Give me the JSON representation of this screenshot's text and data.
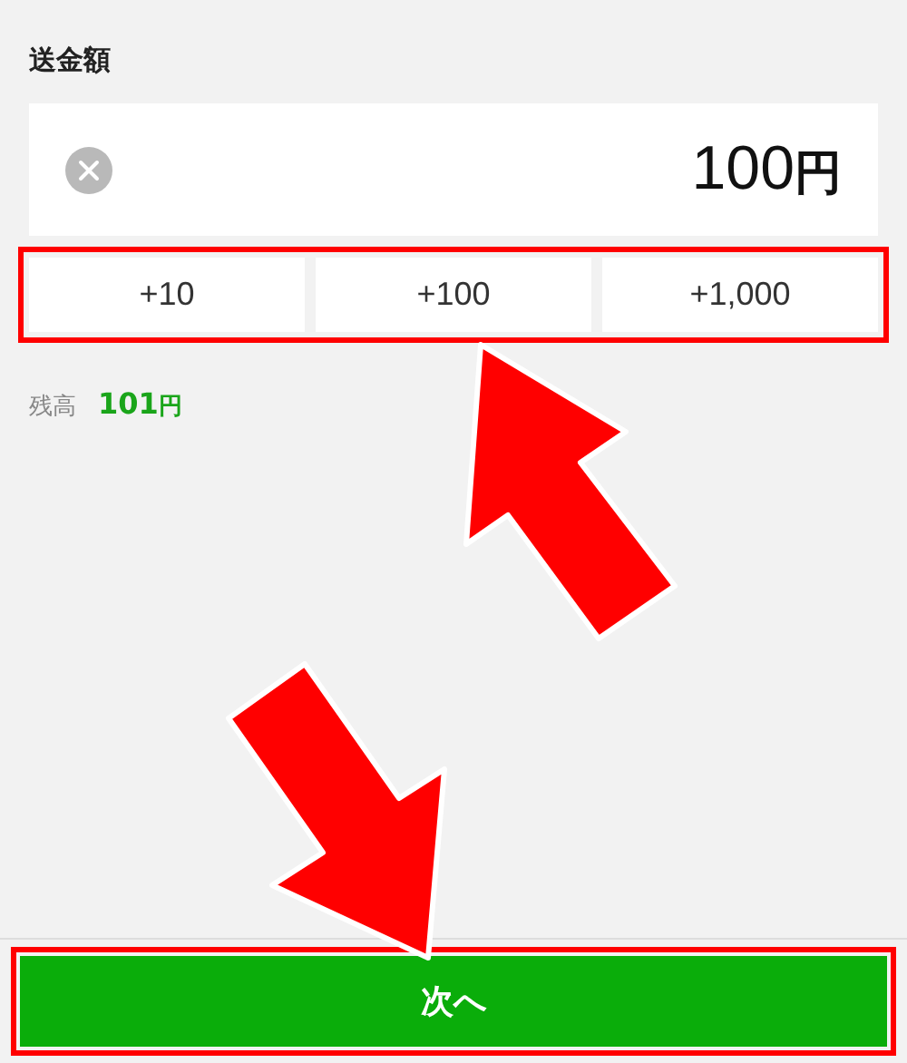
{
  "section_title": "送金額",
  "amount": {
    "value": "100",
    "unit": "円"
  },
  "increments": [
    {
      "label": "+10"
    },
    {
      "label": "+100"
    },
    {
      "label": "+1,000"
    }
  ],
  "balance": {
    "label": "残高",
    "value": "101",
    "unit": "円"
  },
  "next_button": {
    "label": "次へ"
  }
}
